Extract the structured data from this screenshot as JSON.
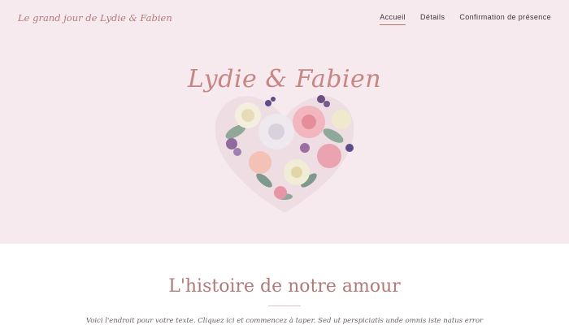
{
  "site": {
    "brand": "Le grand jour de Lydie & Fabien"
  },
  "nav": {
    "items": [
      {
        "label": "Accueil",
        "active": true
      },
      {
        "label": "Détails",
        "active": false
      },
      {
        "label": "Confirmation de présence",
        "active": false
      }
    ]
  },
  "hero": {
    "title": "Lydie & Fabien"
  },
  "story": {
    "title": "L'histoire de notre amour",
    "text": "Voici l'endroit pour votre texte. Cliquez ici et commencez à taper. Sed ut perspiciatis unde omnis iste natus error"
  },
  "colors": {
    "hero_bg": "#f6eaee",
    "accent": "#b07a78"
  }
}
